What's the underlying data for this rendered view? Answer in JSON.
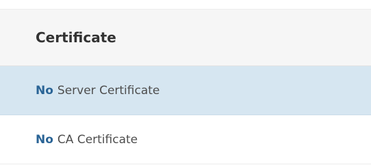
{
  "table": {
    "header": "Certificate",
    "rows": [
      {
        "count": "No",
        "label": "Server Certificate",
        "selected": true
      },
      {
        "count": "No",
        "label": "CA Certificate",
        "selected": false
      }
    ]
  },
  "colors": {
    "header_bg": "#f6f6f6",
    "selected_row_bg": "#d6e6f1",
    "count_text": "#2a6496"
  }
}
